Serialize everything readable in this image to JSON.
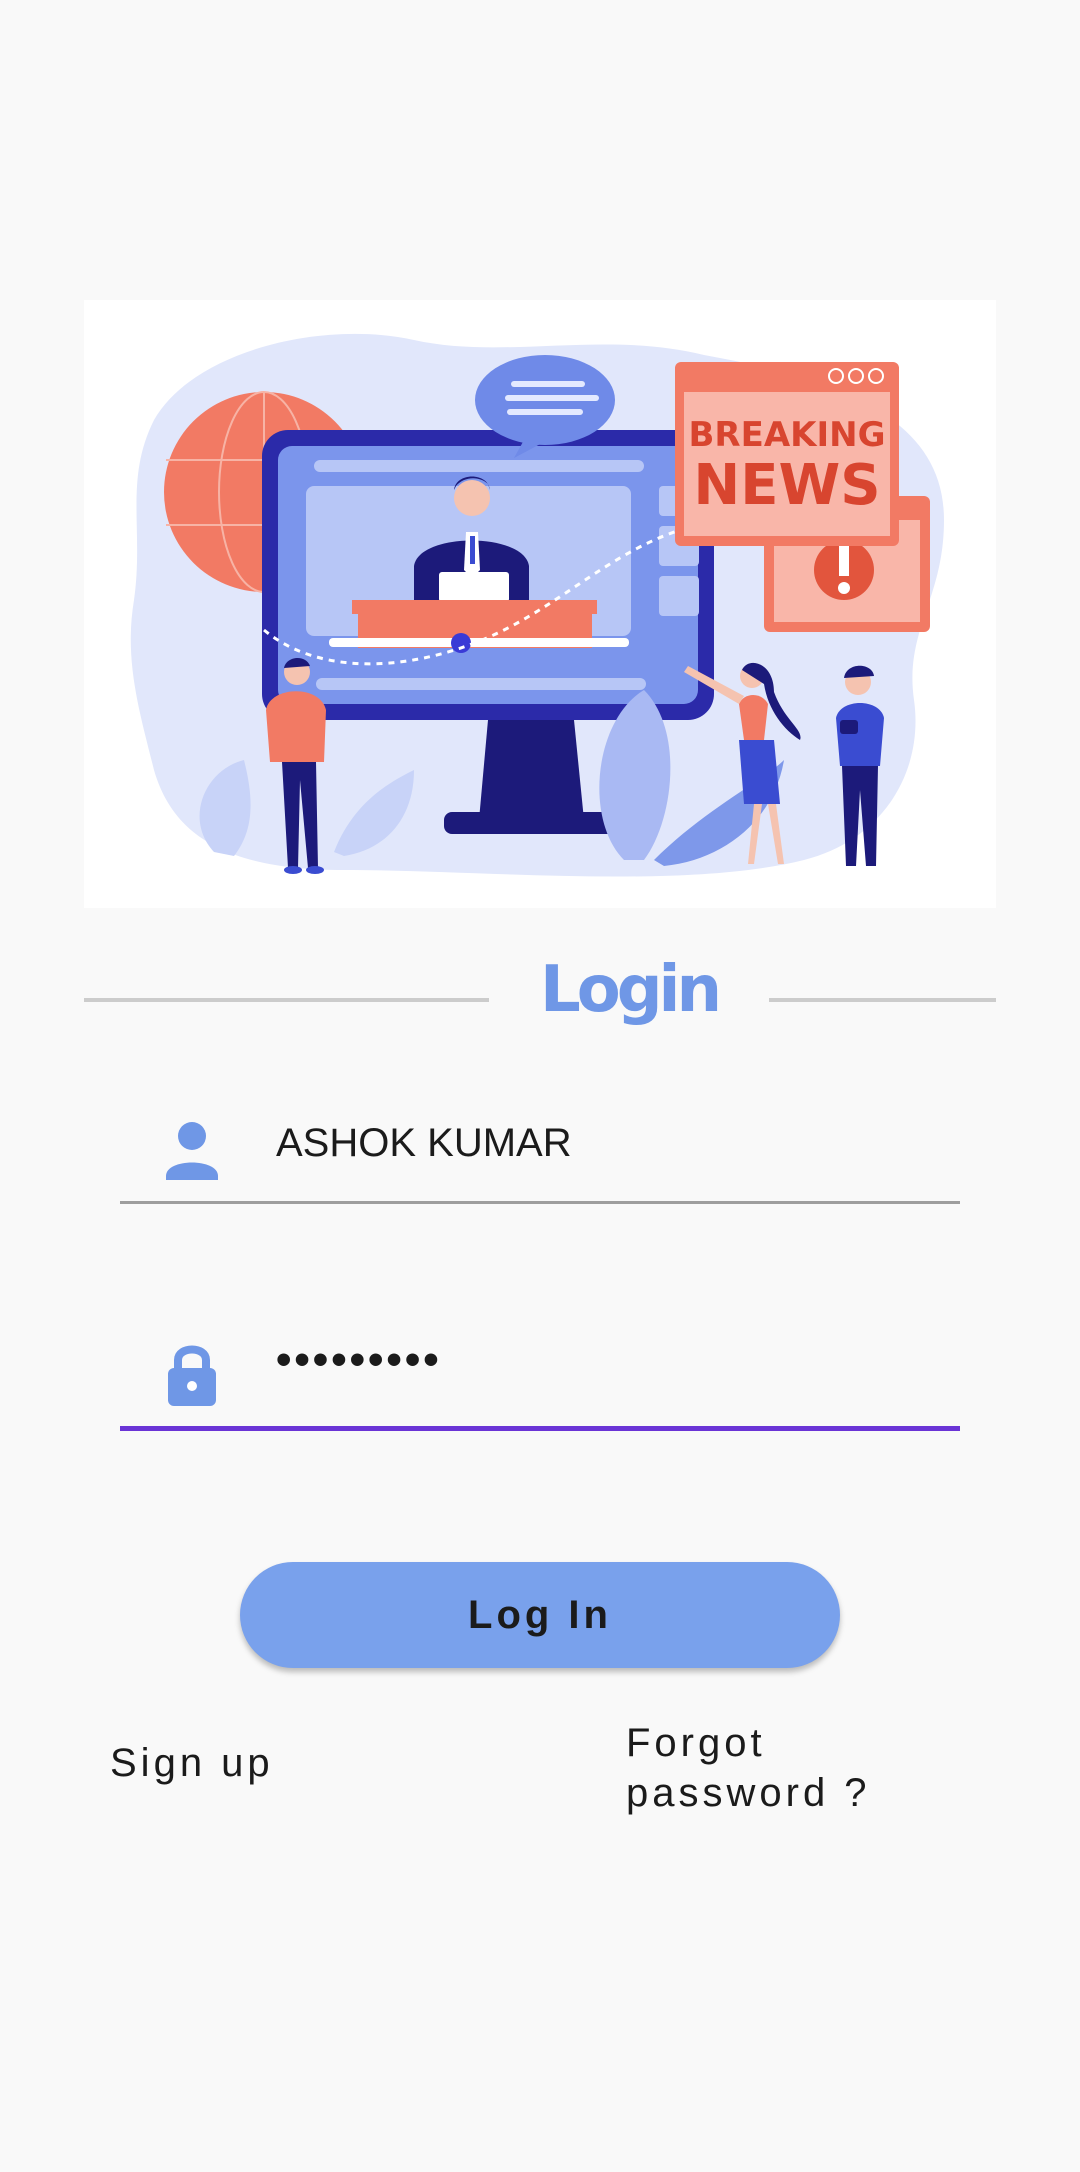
{
  "header": {
    "title": "Login"
  },
  "hero": {
    "sign_line1": "BREAKING",
    "sign_line2": "NEWS"
  },
  "form": {
    "username": {
      "icon": "person-icon",
      "value": "ASHOK KUMAR"
    },
    "password": {
      "icon": "lock-icon",
      "value": "•••••••••"
    },
    "login_button_label": "Log In"
  },
  "links": {
    "signup_label": "Sign up",
    "forgot_line1": "Forgot",
    "forgot_line2": "password ?"
  },
  "colors": {
    "accent": "#6f97e6",
    "button": "#79a1ec",
    "focus_underline": "#6a34d6",
    "background": "#f9f9f9"
  }
}
